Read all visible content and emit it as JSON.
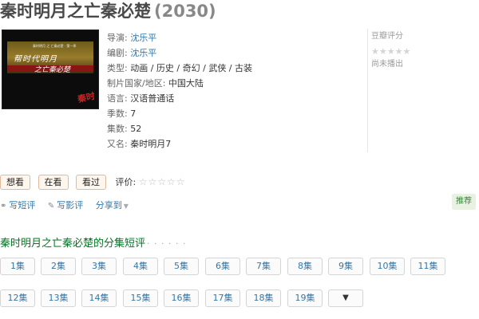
{
  "header": {
    "title": "秦时明月之亡秦必楚",
    "year": "(2030)"
  },
  "poster": {
    "calligraphy_1": "帮时代明月",
    "calligraphy_2": "之亡秦必楚",
    "small_text": "秦时明月 之 亡秦必楚 · 第一季",
    "logo": "秦时"
  },
  "info": {
    "director_label": "导演:",
    "director": "沈乐平",
    "writer_label": "编剧:",
    "writer": "沈乐平",
    "genre_label": "类型:",
    "genre": "动画 / 历史 / 奇幻 / 武侠 / 古装",
    "country_label": "制片国家/地区:",
    "country": "中国大陆",
    "language_label": "语言:",
    "language": "汉语普通话",
    "seasons_label": "季数:",
    "seasons": "7",
    "episodes_label": "集数:",
    "episodes": "52",
    "aka_label": "又名:",
    "aka": "秦时明月7"
  },
  "rating": {
    "title": "豆瓣评分",
    "stars": "★★★★★",
    "note": "尚未播出"
  },
  "actions": {
    "want": "想看",
    "watching": "在看",
    "watched": "看过",
    "rate_label": "评价:",
    "rate_stars": "☆☆☆☆☆"
  },
  "links": {
    "short_review": "写短评",
    "review": "写影评",
    "share": "分享到"
  },
  "recommend": "推荐",
  "episodes_section": {
    "title": "秦时明月之亡秦必楚的分集短评",
    "dots": "· · · · · ·"
  },
  "episode_buttons": [
    "1集",
    "2集",
    "3集",
    "4集",
    "5集",
    "6集",
    "7集",
    "8集",
    "9集",
    "10集",
    "11集",
    "12集",
    "13集",
    "14集",
    "15集",
    "16集",
    "17集",
    "18集",
    "19集"
  ],
  "colors": {
    "link": "#3377aa",
    "section_green": "#007722",
    "button_border": "#e0ba9a"
  }
}
